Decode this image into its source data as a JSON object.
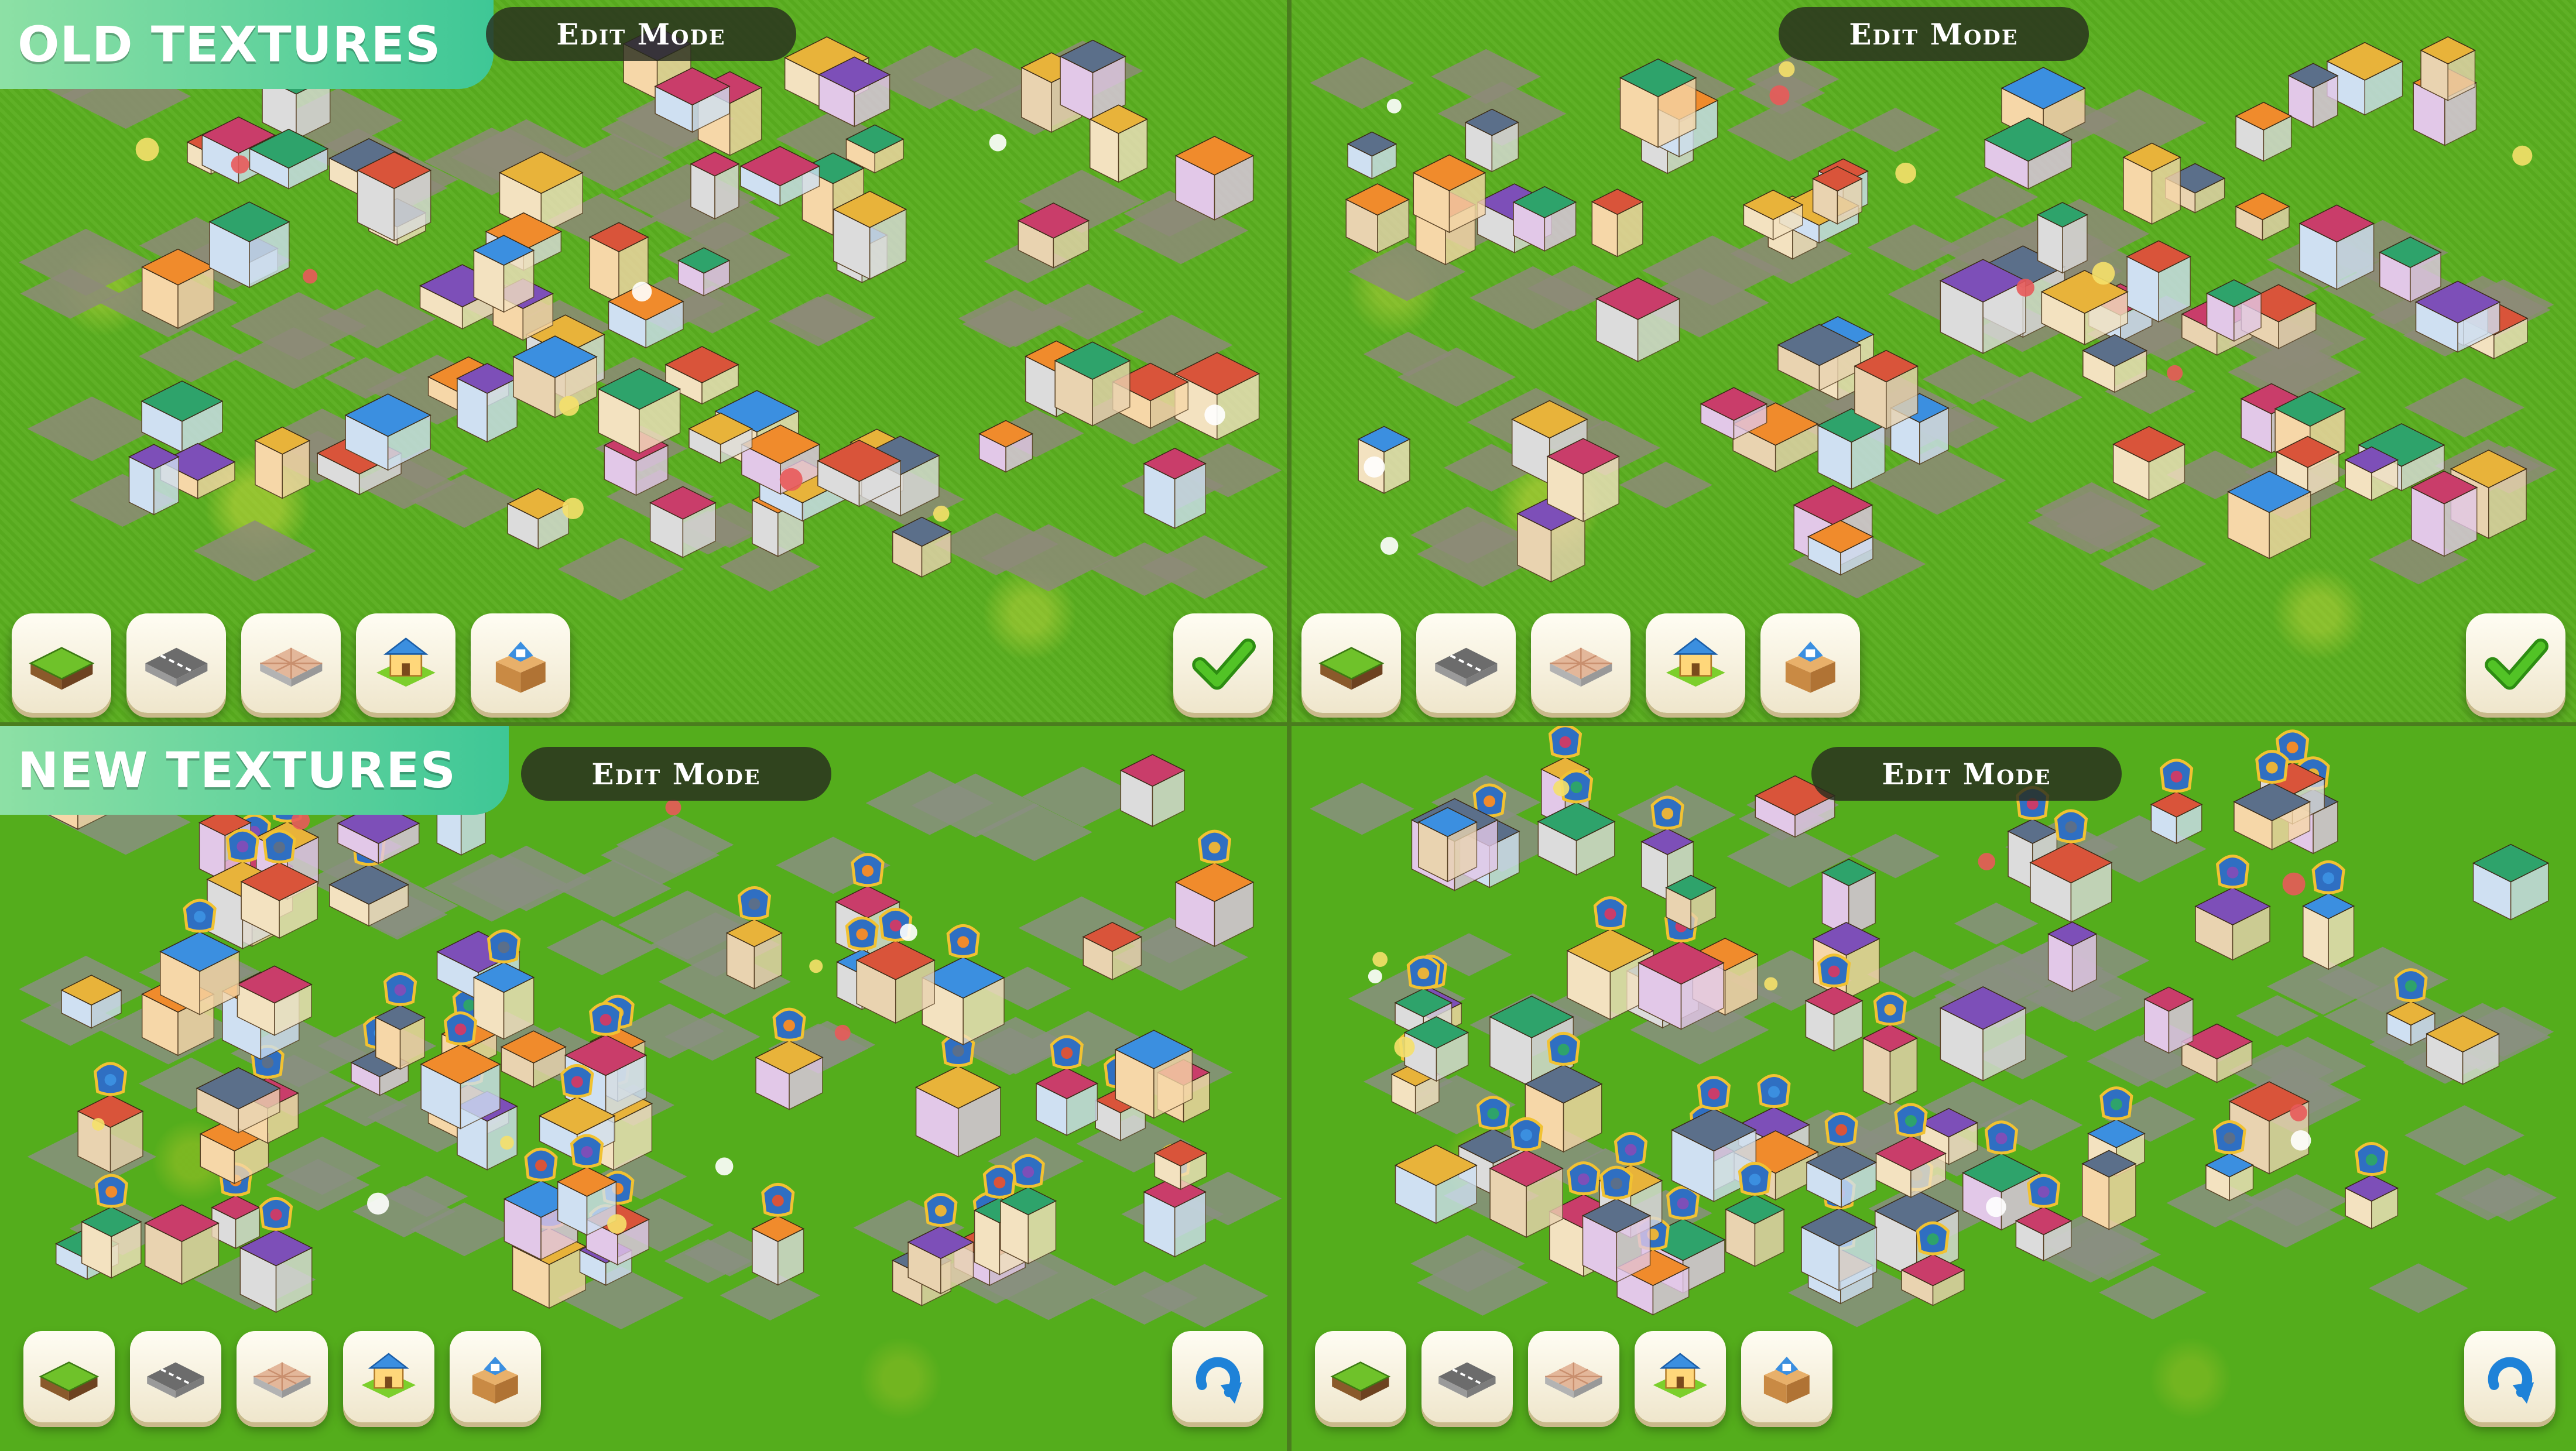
{
  "panels": {
    "old": {
      "label": "OLD TEXTURES"
    },
    "new": {
      "label": "NEW TEXTURES"
    }
  },
  "mode_title": "Edit Mode",
  "toolbar": {
    "tools": [
      "grass-tile-icon",
      "road-tile-icon",
      "pavement-tile-icon",
      "house-icon",
      "storage-box-icon"
    ]
  },
  "actions": {
    "confirm": "checkmark-icon",
    "rotate": "rotate-icon"
  },
  "colors": {
    "grass_old": "#5aae1f",
    "grass_new": "#54ad1c",
    "banner": "#3ec796",
    "pill": "#2d2f22",
    "check": "#39a81a",
    "rotate": "#1e82d8"
  }
}
